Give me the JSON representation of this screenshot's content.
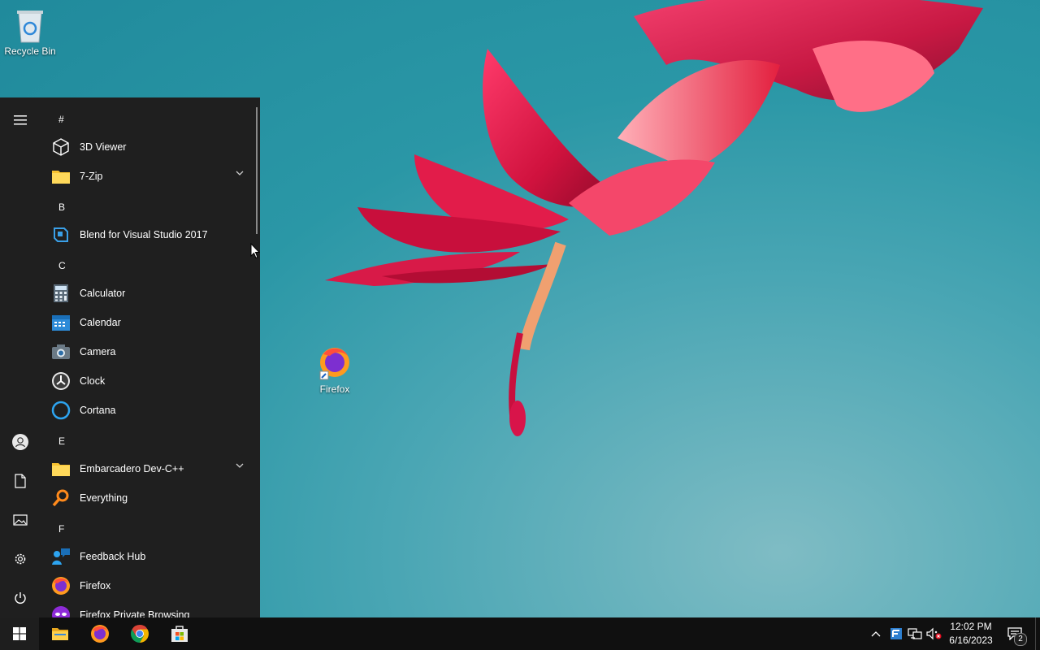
{
  "desktop": {
    "icons": [
      {
        "label": "Recycle Bin"
      },
      {
        "label": "Firefox"
      }
    ]
  },
  "start_menu": {
    "groups": [
      {
        "letter": "#",
        "apps": [
          {
            "label": "3D Viewer",
            "icon": "cube-icon"
          },
          {
            "label": "7-Zip",
            "icon": "folder-icon",
            "expandable": true
          }
        ]
      },
      {
        "letter": "B",
        "apps": [
          {
            "label": "Blend for Visual Studio 2017",
            "icon": "blend-icon"
          }
        ]
      },
      {
        "letter": "C",
        "apps": [
          {
            "label": "Calculator",
            "icon": "calculator-icon"
          },
          {
            "label": "Calendar",
            "icon": "calendar-icon"
          },
          {
            "label": "Camera",
            "icon": "camera-icon"
          },
          {
            "label": "Clock",
            "icon": "clock-icon"
          },
          {
            "label": "Cortana",
            "icon": "cortana-icon"
          }
        ]
      },
      {
        "letter": "E",
        "apps": [
          {
            "label": "Embarcadero Dev-C++",
            "icon": "folder-icon",
            "expandable": true
          },
          {
            "label": "Everything",
            "icon": "magnifier-icon"
          }
        ]
      },
      {
        "letter": "F",
        "apps": [
          {
            "label": "Feedback Hub",
            "icon": "feedback-icon"
          },
          {
            "label": "Firefox",
            "icon": "firefox-icon"
          },
          {
            "label": "Firefox Private Browsing",
            "icon": "private-browsing-icon"
          }
        ]
      }
    ],
    "rail": [
      "menu-icon",
      "user-icon",
      "documents-icon",
      "pictures-icon",
      "settings-icon",
      "power-icon"
    ]
  },
  "taskbar": {
    "pinned": [
      "windows-start-icon",
      "file-explorer-icon",
      "firefox-icon",
      "chrome-icon",
      "store-icon"
    ],
    "clock": {
      "time": "12:02 PM",
      "date": "6/16/2023"
    },
    "notification_count": "2"
  },
  "colors": {
    "start_bg": "#1f1f1f",
    "taskbar_bg": "#101010",
    "accent_blue": "#0078d7"
  }
}
